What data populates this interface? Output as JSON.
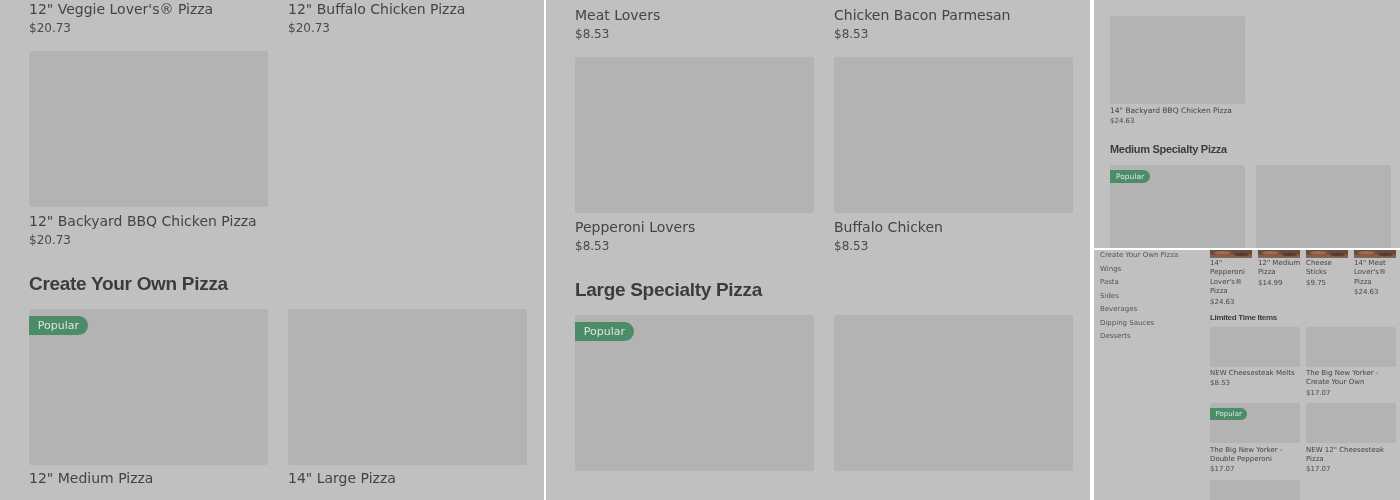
{
  "panels": [
    {
      "kind": "wide",
      "blocks": [
        {
          "kind": "grid",
          "items": [
            {
              "kind": "caption",
              "name": "12\" Veggie Lover's® Pizza",
              "price": "$20.73"
            },
            {
              "kind": "caption",
              "name": "12\" Buffalo Chicken Pizza",
              "price": "$20.73"
            }
          ]
        },
        {
          "kind": "grid",
          "items": [
            {
              "kind": "card",
              "name": "12\" Backyard BBQ Chicken Pizza",
              "price": "$20.73"
            }
          ]
        },
        {
          "kind": "heading",
          "text": "Create Your Own Pizza"
        },
        {
          "kind": "grid",
          "items": [
            {
              "kind": "card",
              "badge": "Popular",
              "name": "12\" Medium Pizza"
            },
            {
              "kind": "card",
              "name": "14\" Large Pizza"
            }
          ]
        }
      ]
    },
    {
      "kind": "wide",
      "blocks": [
        {
          "kind": "grid",
          "items": [
            {
              "kind": "caption",
              "name": "Meat Lovers",
              "price": "$8.53"
            },
            {
              "kind": "caption",
              "name": "Chicken Bacon Parmesan",
              "price": "$8.53"
            }
          ]
        },
        {
          "kind": "grid",
          "items": [
            {
              "kind": "card",
              "name": "Pepperoni Lovers",
              "price": "$8.53"
            },
            {
              "kind": "card",
              "name": "Buffalo Chicken",
              "price": "$8.53"
            }
          ]
        },
        {
          "kind": "heading",
          "text": "Large Specialty Pizza"
        },
        {
          "kind": "grid",
          "items": [
            {
              "kind": "card",
              "badge": "Popular"
            },
            {
              "kind": "card"
            }
          ]
        }
      ]
    },
    {
      "kind": "compact",
      "blocks": [
        {
          "kind": "grid",
          "items": [
            {
              "kind": "card",
              "name": "14\" Backyard BBQ Chicken Pizza",
              "price": "$24.63"
            }
          ]
        },
        {
          "kind": "heading",
          "text": "Medium Specialty Pizza"
        },
        {
          "kind": "grid",
          "items": [
            {
              "kind": "card",
              "badge": "Popular"
            },
            {
              "kind": "card"
            }
          ]
        }
      ]
    },
    {
      "kind": "mini",
      "sidebar": [
        "Create Your Own Pizza",
        "Wings",
        "Pasta",
        "Sides",
        "Beverages",
        "Dipping Sauces",
        "Desserts"
      ],
      "blocks": [
        {
          "kind": "thumbs",
          "items": [
            {
              "name": "14\" Pepperoni Lover's® Pizza",
              "price": "$24.63"
            },
            {
              "name": "12\" Medium Pizza",
              "price": "$14.99"
            },
            {
              "name": "Cheese Sticks",
              "price": "$9.75"
            },
            {
              "name": "14\" Meat Lover's® Pizza",
              "price": "$24.63"
            }
          ]
        },
        {
          "kind": "heading",
          "text": "Limited Time Items"
        },
        {
          "kind": "grid",
          "items": [
            {
              "kind": "card",
              "name": "NEW Cheesesteak Melts",
              "price": "$8.53"
            },
            {
              "kind": "card",
              "name": "The Big New Yorker - Create Your Own",
              "price": "$17.07"
            }
          ]
        },
        {
          "kind": "grid",
          "items": [
            {
              "kind": "card",
              "badge": "Popular",
              "name": "The Big New Yorker - Double Pepperoni",
              "price": "$17.07"
            },
            {
              "kind": "card",
              "name": "NEW 12\" Cheesesteak Pizza",
              "price": "$17.07"
            }
          ]
        },
        {
          "kind": "grid",
          "items": [
            {
              "kind": "card"
            }
          ]
        }
      ]
    }
  ]
}
